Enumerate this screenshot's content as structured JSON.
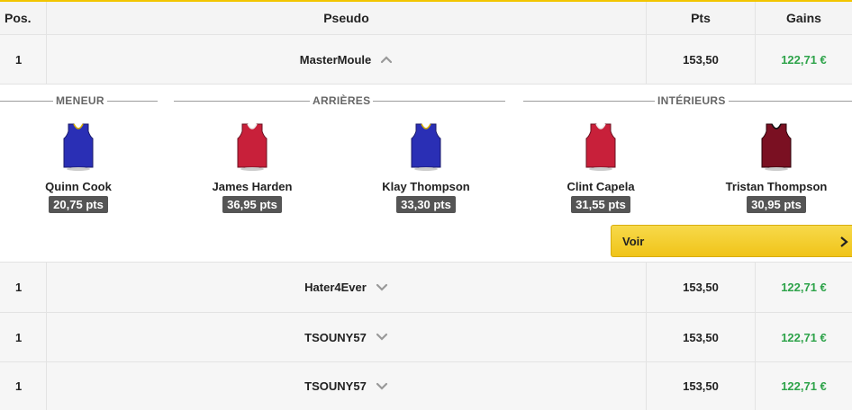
{
  "header": {
    "pos": "Pos.",
    "pseudo": "Pseudo",
    "pts": "Pts",
    "gains": "Gains"
  },
  "rows": [
    {
      "pos": "1",
      "pseudo": "MasterMoule",
      "pts": "153,50",
      "gains": "122,71 €",
      "expanded": true
    },
    {
      "pos": "1",
      "pseudo": "Hater4Ever",
      "pts": "153,50",
      "gains": "122,71 €",
      "expanded": false
    },
    {
      "pos": "1",
      "pseudo": "TSOUNY57",
      "pts": "153,50",
      "gains": "122,71 €",
      "expanded": false
    },
    {
      "pos": "1",
      "pseudo": "TSOUNY57",
      "pts": "153,50",
      "gains": "122,71 €",
      "expanded": false
    }
  ],
  "lineup": {
    "sections": [
      "MENEUR",
      "ARRIÈRES",
      "INTÉRIEURS"
    ],
    "players": [
      {
        "name": "Quinn Cook",
        "pts": "20,75 pts",
        "jersey_color": "#2a2fb5"
      },
      {
        "name": "James Harden",
        "pts": "36,95 pts",
        "jersey_color": "#c8203a"
      },
      {
        "name": "Klay Thompson",
        "pts": "33,30 pts",
        "jersey_color": "#2a2fb5"
      },
      {
        "name": "Clint Capela",
        "pts": "31,55 pts",
        "jersey_color": "#c8203a"
      },
      {
        "name": "Tristan Thompson",
        "pts": "30,95 pts",
        "jersey_color": "#7a1022"
      }
    ],
    "voir_label": "Voir"
  },
  "colors": {
    "accent": "#f2c500",
    "gain": "#2ea34a",
    "badge": "#555555"
  }
}
